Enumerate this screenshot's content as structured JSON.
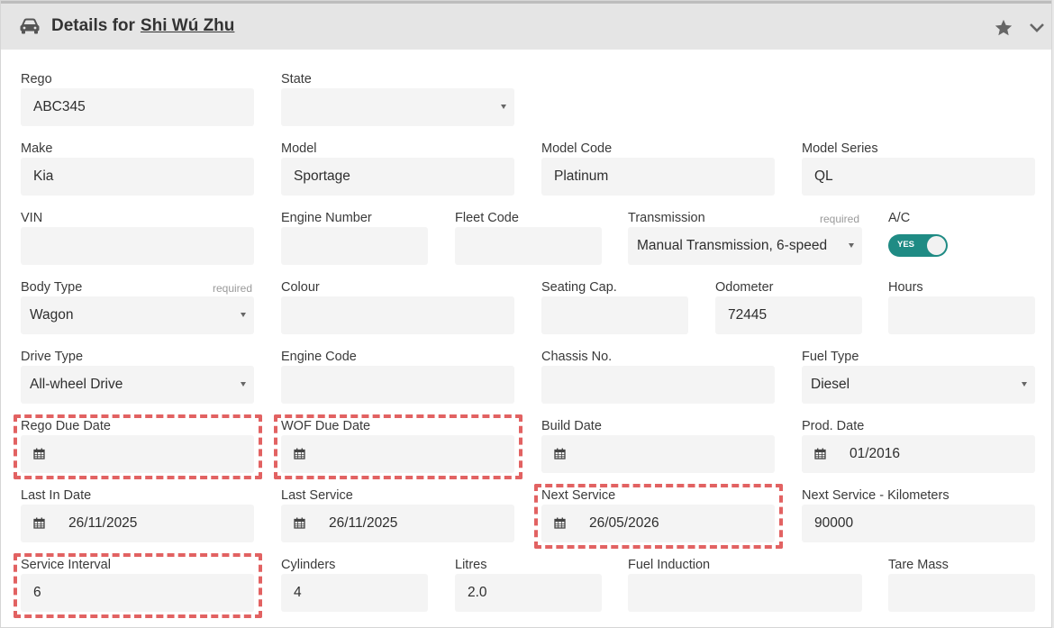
{
  "header": {
    "title_prefix": "Details for",
    "person_name": "Shi Wú Zhu",
    "icon": "car-icon"
  },
  "fields": {
    "rego": {
      "label": "Rego",
      "value": "ABC345"
    },
    "state": {
      "label": "State",
      "value": ""
    },
    "make": {
      "label": "Make",
      "value": "Kia"
    },
    "model": {
      "label": "Model",
      "value": "Sportage"
    },
    "model_code": {
      "label": "Model Code",
      "value": "Platinum"
    },
    "model_series": {
      "label": "Model Series",
      "value": "QL"
    },
    "vin": {
      "label": "VIN",
      "value": ""
    },
    "engine_number": {
      "label": "Engine Number",
      "value": ""
    },
    "fleet_code": {
      "label": "Fleet Code",
      "value": ""
    },
    "transmission": {
      "label": "Transmission",
      "required": "required",
      "value": "Manual Transmission, 6-speed"
    },
    "ac": {
      "label": "A/C",
      "toggle_text": "YES",
      "on": true
    },
    "body_type": {
      "label": "Body Type",
      "required": "required",
      "value": "Wagon"
    },
    "colour": {
      "label": "Colour",
      "value": ""
    },
    "seating_cap": {
      "label": "Seating Cap.",
      "value": ""
    },
    "odometer": {
      "label": "Odometer",
      "value": "72445"
    },
    "hours": {
      "label": "Hours",
      "value": ""
    },
    "drive_type": {
      "label": "Drive Type",
      "value": "All-wheel Drive"
    },
    "engine_code": {
      "label": "Engine Code",
      "value": ""
    },
    "chassis_no": {
      "label": "Chassis No.",
      "value": ""
    },
    "fuel_type": {
      "label": "Fuel Type",
      "value": "Diesel"
    },
    "rego_due_date": {
      "label": "Rego Due Date",
      "value": ""
    },
    "wof_due_date": {
      "label": "WOF Due Date",
      "value": ""
    },
    "build_date": {
      "label": "Build Date",
      "value": ""
    },
    "prod_date": {
      "label": "Prod. Date",
      "value": "01/2016"
    },
    "last_in_date": {
      "label": "Last In Date",
      "value": "26/11/2025"
    },
    "last_service": {
      "label": "Last Service",
      "value": "26/11/2025"
    },
    "next_service": {
      "label": "Next Service",
      "value": "26/05/2026"
    },
    "next_service_km": {
      "label": "Next Service - Kilometers",
      "value": "90000"
    },
    "service_interval": {
      "label": "Service Interval",
      "value": "6"
    },
    "cylinders": {
      "label": "Cylinders",
      "value": "4"
    },
    "litres": {
      "label": "Litres",
      "value": "2.0"
    },
    "fuel_induction": {
      "label": "Fuel Induction",
      "value": ""
    },
    "tare_mass": {
      "label": "Tare Mass",
      "value": ""
    }
  },
  "colors": {
    "accent_toggle": "#1f8b84",
    "highlight": "#e26262",
    "header_bg": "#e5e5e5",
    "input_bg": "#f4f4f4"
  }
}
